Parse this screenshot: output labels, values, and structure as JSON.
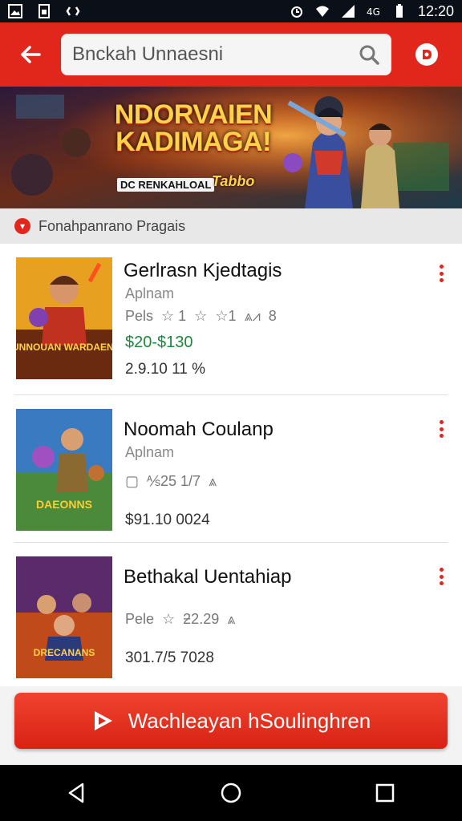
{
  "status_bar": {
    "time": "12:20",
    "icons": [
      "gallery-icon",
      "sim-icon",
      "signal-cluster-icon",
      "alarm-icon",
      "wifi-icon",
      "cell-signal-icon",
      "battery-icon"
    ]
  },
  "app_bar": {
    "back_icon": "back-arrow-icon",
    "search": {
      "value": "Bnckah Unnaesni",
      "icon": "search-icon"
    },
    "profile_icon": "profile-badge-icon",
    "accent_color": "#e1261c"
  },
  "banner": {
    "title_line1": "NDORVAIEN",
    "title_line2": "KADIMAGA!",
    "subtitle": "DC RENKAHLOAL",
    "tag": "Tabbo"
  },
  "category": {
    "label": "Fonahpanrano Pragais",
    "icon": "category-badge-icon"
  },
  "items": [
    {
      "title": "Gerlrasn Kjedtagis",
      "sub": "Aplnam",
      "meta": [
        "Pels",
        "☆ 1",
        "☆",
        "☆1",
        "⩓⩘",
        "8"
      ],
      "price": "$20-$130",
      "size": "2.9.10 11 %",
      "thumb_text": "DUNNOUAN WARDAENE!"
    },
    {
      "title": "Noomah Coulanp",
      "sub": "Aplnam",
      "meta": [
        "▢",
        "⅍25 1/7",
        "⩓"
      ],
      "price": "",
      "size": "$91.10 0024",
      "thumb_text": "DAEONNS"
    },
    {
      "title": "Bethakal Uentahiap",
      "sub": "",
      "meta": [
        "Pele",
        "☆",
        "ƻ2.29",
        "⩓"
      ],
      "price": "",
      "size": "301.7/5 7028",
      "thumb_text": "DRECANANS"
    }
  ],
  "cta": {
    "label": "Wachleayan hSoulinghren",
    "icon": "play-icon"
  },
  "nav": {
    "back": "nav-back-icon",
    "home": "nav-home-icon",
    "recents": "nav-recents-icon"
  }
}
